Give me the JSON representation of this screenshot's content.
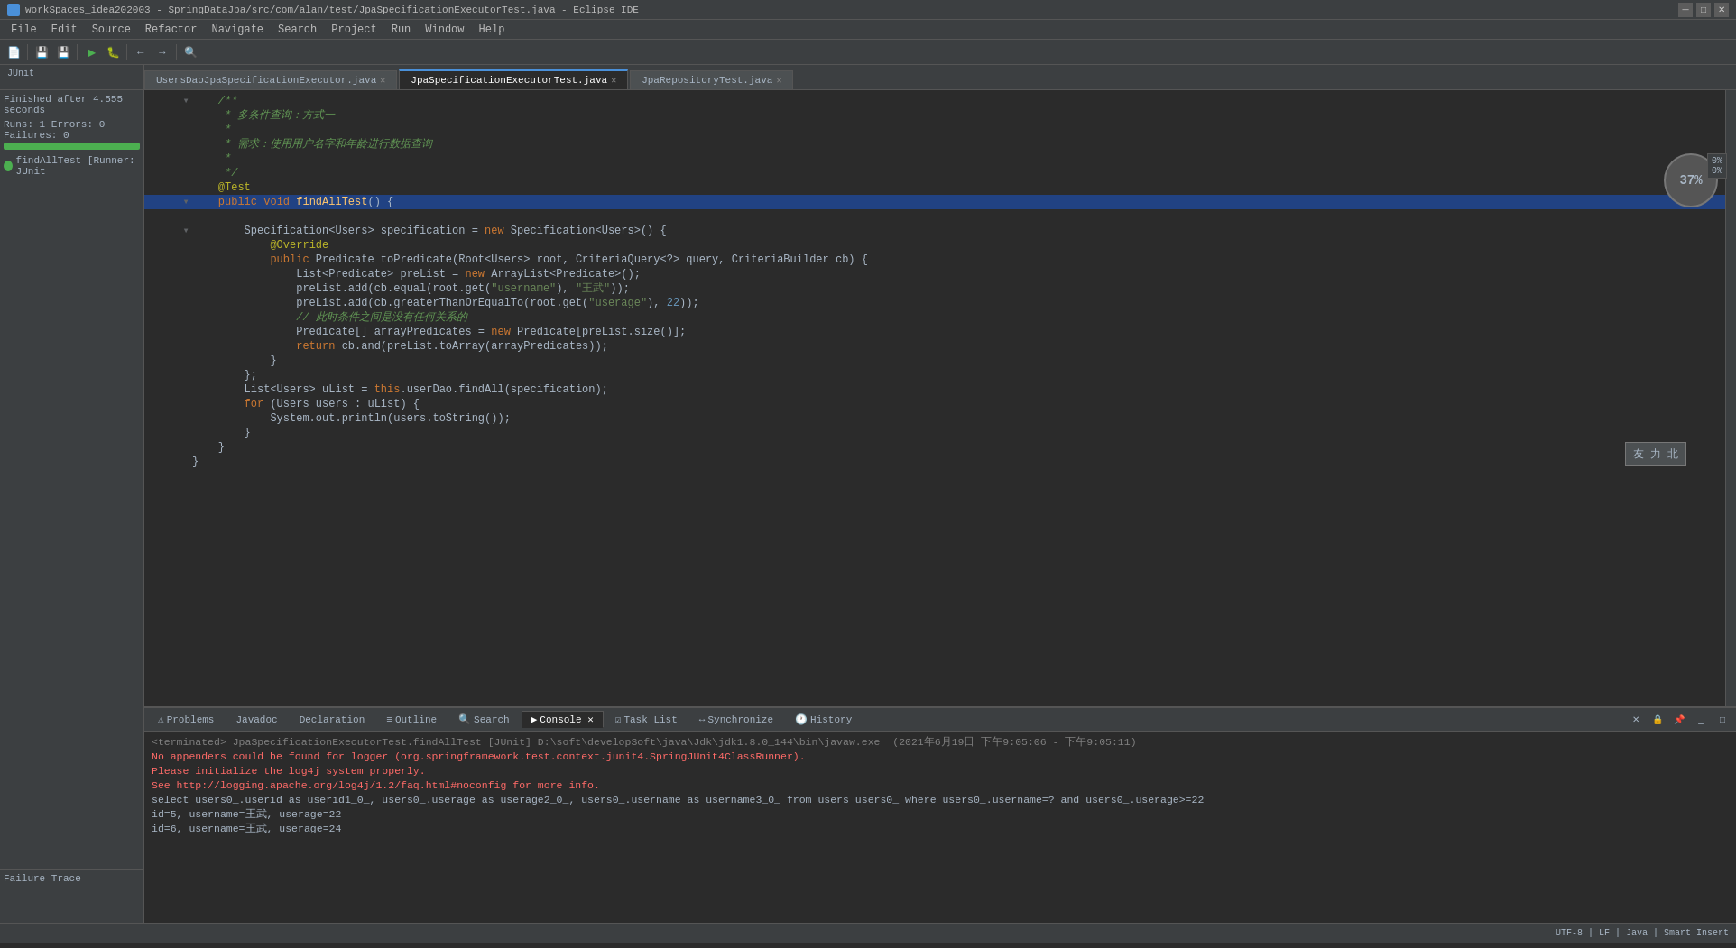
{
  "titleBar": {
    "title": "workSpaces_idea202003 - SpringDataJpa/src/com/alan/test/JpaSpecificationExecutorTest.java - Eclipse IDE",
    "icon": "eclipse-icon",
    "minimize": "─",
    "maximize": "□",
    "close": "✕"
  },
  "menuBar": {
    "items": [
      "File",
      "Edit",
      "Source",
      "Refactor",
      "Navigate",
      "Search",
      "Project",
      "Run",
      "Window",
      "Help"
    ]
  },
  "editorTabs": [
    {
      "label": "UsersDaoJpaSpecificationExecutor.java",
      "active": false
    },
    {
      "label": "JpaSpecificationExecutorTest.java",
      "active": true
    },
    {
      "label": "JpaRepositoryTest.java",
      "active": false
    }
  ],
  "testPanel": {
    "runInfo": "Finished after 4.555 seconds",
    "runs": "Runs: 1",
    "errors": "Errors: 0",
    "failures": "Failures: 0",
    "testItem": "findAllTest [Runner: JUnit"
  },
  "perfBadge": {
    "percent": "37%",
    "val1": "0%",
    "val2": "0%"
  },
  "cnBadge": {
    "text": "友 力 北"
  },
  "codeLines": [
    {
      "num": "",
      "fold": "▾",
      "content": "    /**",
      "class": "cm"
    },
    {
      "num": "",
      "fold": " ",
      "content": "     * 多条件查询：方式一",
      "class": "cm"
    },
    {
      "num": "",
      "fold": " ",
      "content": "     *",
      "class": "cm"
    },
    {
      "num": "",
      "fold": " ",
      "content": "     * 需求：使用用户名字和年龄进行数据查询",
      "class": "cm"
    },
    {
      "num": "",
      "fold": " ",
      "content": "     *",
      "class": "cm"
    },
    {
      "num": "",
      "fold": " ",
      "content": "     */",
      "class": "cm"
    },
    {
      "num": "",
      "fold": " ",
      "content": "    @Test",
      "class": "an"
    },
    {
      "num": "",
      "fold": "▾",
      "content": "    public void findAllTest() {",
      "class": "highlighted"
    },
    {
      "num": "",
      "fold": " ",
      "content": "",
      "class": ""
    },
    {
      "num": "",
      "fold": "▾",
      "content": "        Specification<Users> specification = new Specification<Users>() {",
      "class": ""
    },
    {
      "num": "",
      "fold": " ",
      "content": "            @Override",
      "class": "an"
    },
    {
      "num": "",
      "fold": " ",
      "content": "            public Predicate toPredicate(Root<Users> root, CriteriaQuery<?> query, CriteriaBuilder cb) {",
      "class": ""
    },
    {
      "num": "",
      "fold": " ",
      "content": "                List<Predicate> preList = new ArrayList<Predicate>();",
      "class": ""
    },
    {
      "num": "",
      "fold": " ",
      "content": "                preList.add(cb.equal(root.get(\"username\"), \"王武\"));",
      "class": ""
    },
    {
      "num": "",
      "fold": " ",
      "content": "                preList.add(cb.greaterThanOrEqualTo(root.get(\"userage\"), 22));",
      "class": ""
    },
    {
      "num": "",
      "fold": " ",
      "content": "                // 此时条件之间是没有任何关系的",
      "class": "cm"
    },
    {
      "num": "",
      "fold": " ",
      "content": "                Predicate[] arrayPredicates = new Predicate[preList.size()];",
      "class": ""
    },
    {
      "num": "",
      "fold": " ",
      "content": "                return cb.and(preList.toArray(arrayPredicates));",
      "class": ""
    },
    {
      "num": "",
      "fold": " ",
      "content": "            }",
      "class": ""
    },
    {
      "num": "",
      "fold": " ",
      "content": "        };",
      "class": ""
    },
    {
      "num": "",
      "fold": " ",
      "content": "        List<Users> uList = this.userDao.findAll(specification);",
      "class": ""
    },
    {
      "num": "",
      "fold": " ",
      "content": "        for (Users users : uList) {",
      "class": ""
    },
    {
      "num": "",
      "fold": " ",
      "content": "            System.out.println(users.toString());",
      "class": ""
    },
    {
      "num": "",
      "fold": " ",
      "content": "        }",
      "class": ""
    },
    {
      "num": "",
      "fold": " ",
      "content": "    }",
      "class": ""
    },
    {
      "num": "",
      "fold": " ",
      "content": "}",
      "class": ""
    }
  ],
  "bottomTabs": [
    {
      "label": "Problems",
      "icon": "⚠",
      "active": false
    },
    {
      "label": "Javadoc",
      "icon": "",
      "active": false
    },
    {
      "label": "Declaration",
      "icon": "",
      "active": false
    },
    {
      "label": "Outline",
      "icon": "≡",
      "active": false
    },
    {
      "label": "Search",
      "icon": "🔍",
      "active": false
    },
    {
      "label": "Console",
      "icon": "▶",
      "active": true
    },
    {
      "label": "Task List",
      "icon": "☑",
      "active": false
    },
    {
      "label": "Synchronize",
      "icon": "↔",
      "active": false
    },
    {
      "label": "History",
      "icon": "🕐",
      "active": false
    }
  ],
  "consoleLines": [
    {
      "text": "<terminated> JpaSpecificationExecutorTest.findAllTest [JUnit] D:\\soft\\developSoft\\java\\Jdk\\jdk1.8.0_144\\bin\\javaw.exe  (2021年6月19日 下午9:05:06 - 下午9:05:11)",
      "class": "console-terminated"
    },
    {
      "text": "No appenders could be found for logger (org.springframework.test.context.junit4.SpringJUnit4ClassRunner).",
      "class": "console-error"
    },
    {
      "text": "Please initialize the log4j system properly.",
      "class": "console-error"
    },
    {
      "text": "See http://logging.apache.org/log4j/1.2/faq.html#noconfig for more info.",
      "class": "console-warn"
    },
    {
      "text": "select users0_.userid as userid1_0_, users0_.userage as userage2_0_, users0_.username as username3_0_ from users users0_ where users0_.username=? and users0_.userage>=22",
      "class": "console-sql"
    },
    {
      "text": "id=5, username=王武, userage=22",
      "class": "console-result"
    },
    {
      "text": "id=6, username=王武, userage=24",
      "class": "console-result"
    }
  ],
  "statusBar": {
    "text": ""
  }
}
